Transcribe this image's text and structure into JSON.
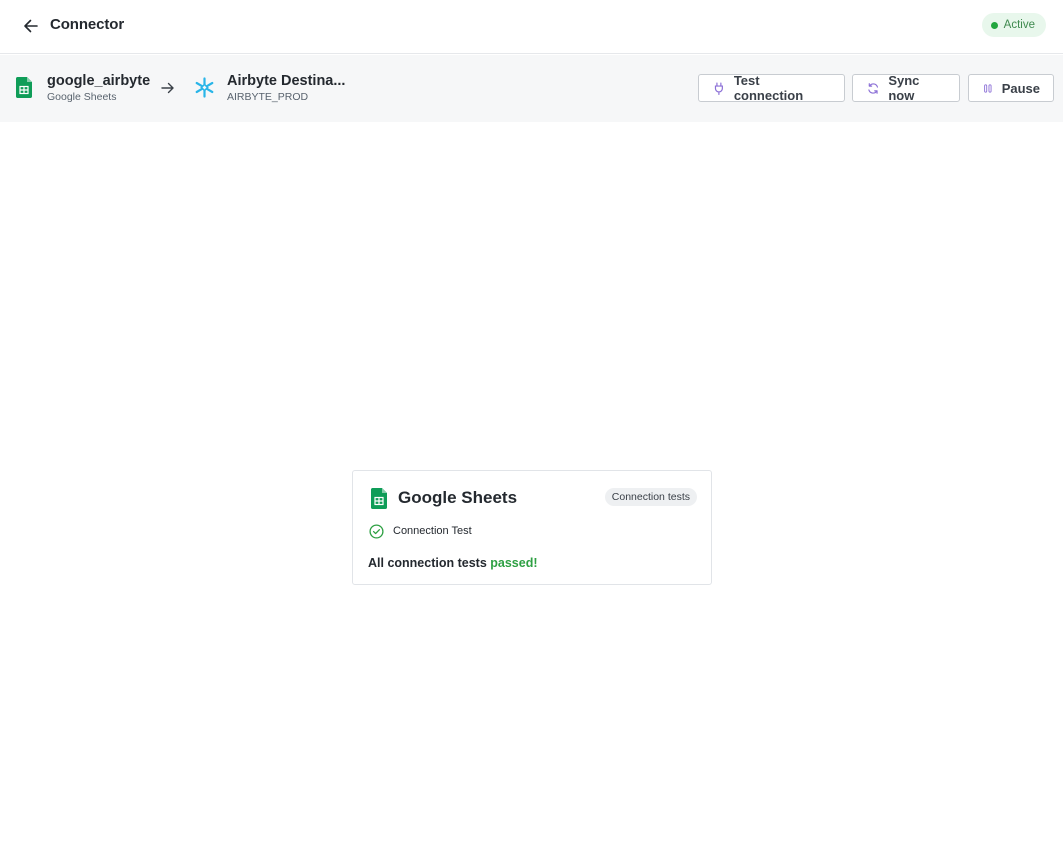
{
  "header": {
    "title": "Connector",
    "status": "Active",
    "back_icon": "arrow-left-icon"
  },
  "connection": {
    "source": {
      "name": "google_airbyte",
      "type": "Google Sheets",
      "icon": "google-sheets-icon"
    },
    "destination": {
      "name": "Airbyte Destina...",
      "type": "AIRBYTE_PROD",
      "icon": "snowflake-icon"
    },
    "arrow_icon": "arrow-right-icon"
  },
  "actions": {
    "test_label": "Test connection",
    "sync_label": "Sync now",
    "pause_label": "Pause"
  },
  "card": {
    "title": "Google Sheets",
    "badge": "Connection tests",
    "test_name": "Connection Test",
    "result_prefix": "All connection tests",
    "result_status": "passed!"
  },
  "colors": {
    "active_green": "#22a63e",
    "sheets_green": "#0f9d58",
    "snowflake_blue": "#29b5e8",
    "pass_green": "#2ea043",
    "pause_purple": "#8b6fd6"
  }
}
